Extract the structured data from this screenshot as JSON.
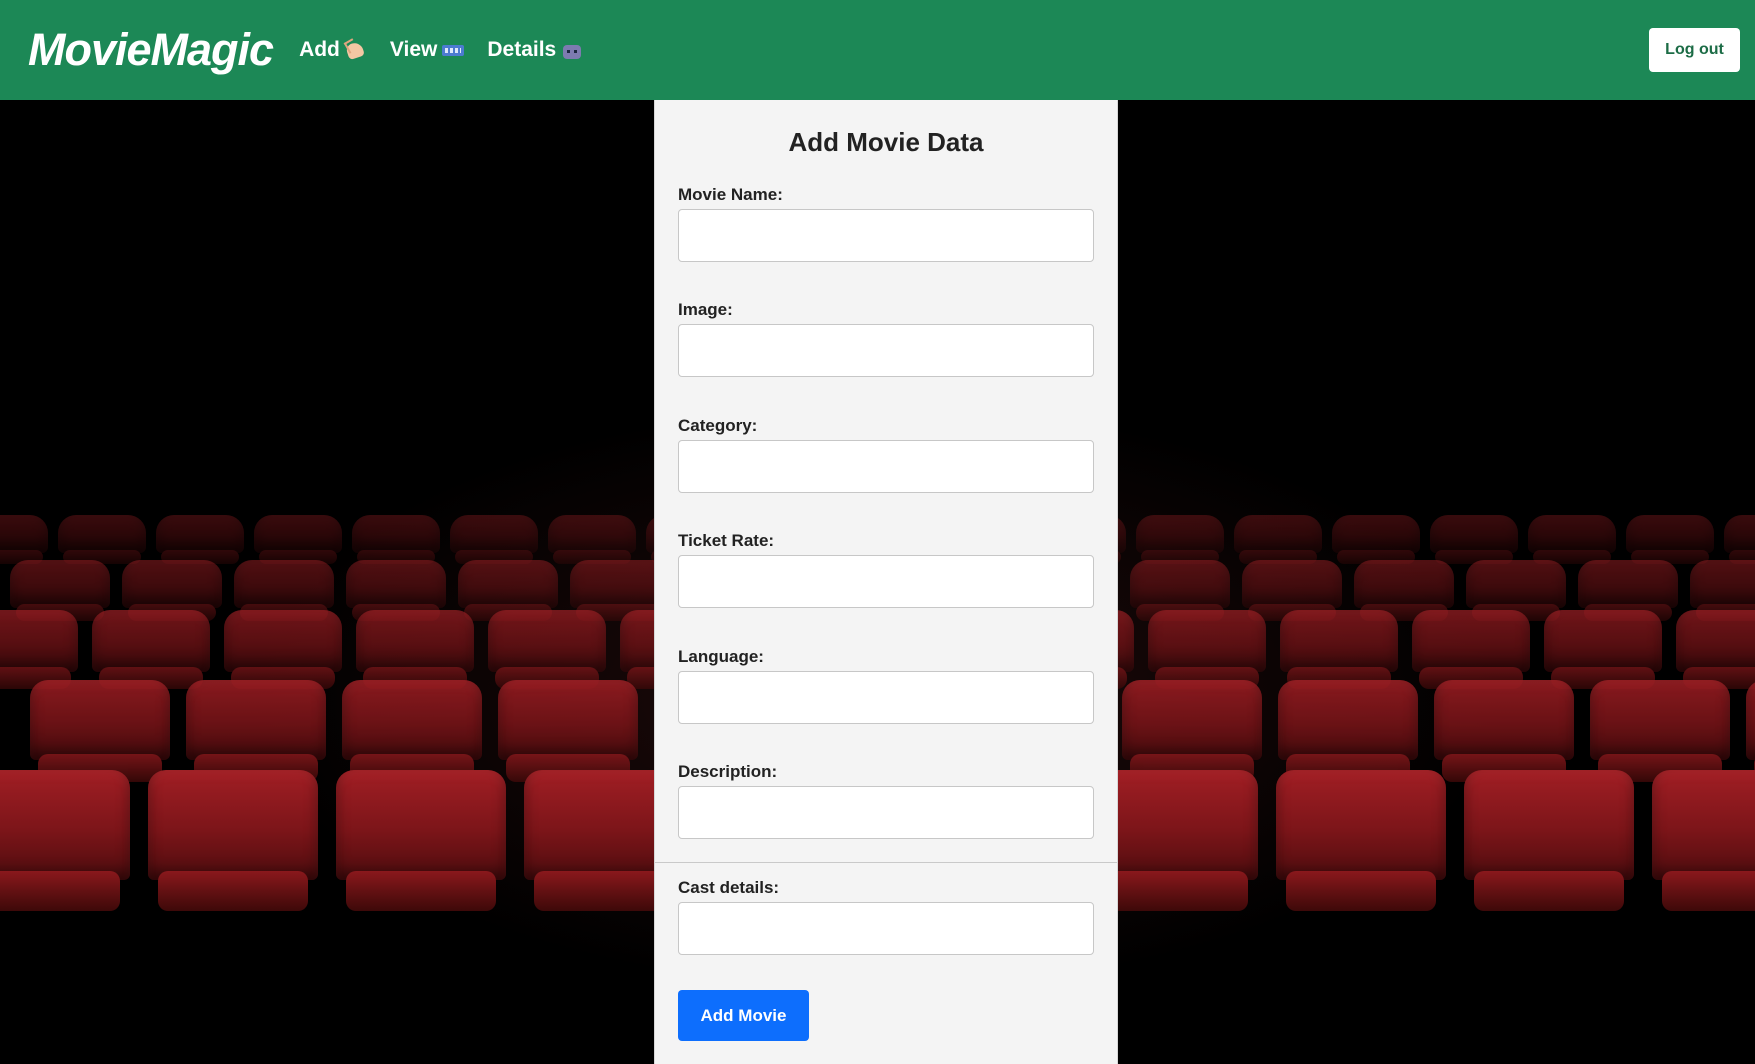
{
  "header": {
    "brand": "MovieMagic",
    "nav": [
      {
        "label": "Add",
        "icon": "writing-hand-icon"
      },
      {
        "label": "View",
        "icon": "film-frames-icon"
      },
      {
        "label": "Details",
        "icon": "robot-icon"
      }
    ],
    "logout_label": "Log out"
  },
  "form": {
    "title": "Add Movie Data",
    "fields": [
      {
        "label": "Movie Name:",
        "value": ""
      },
      {
        "label": "Image:",
        "value": ""
      },
      {
        "label": "Category:",
        "value": ""
      },
      {
        "label": "Ticket Rate:",
        "value": ""
      },
      {
        "label": "Language:",
        "value": ""
      },
      {
        "label": "Description:",
        "value": ""
      },
      {
        "label": "Cast details:",
        "value": ""
      }
    ],
    "submit_label": "Add Movie"
  },
  "colors": {
    "header_bg": "#1c8856",
    "primary_button": "#0d6efd",
    "card_bg": "#f4f4f4",
    "seat_red": "#8e1a1f"
  }
}
